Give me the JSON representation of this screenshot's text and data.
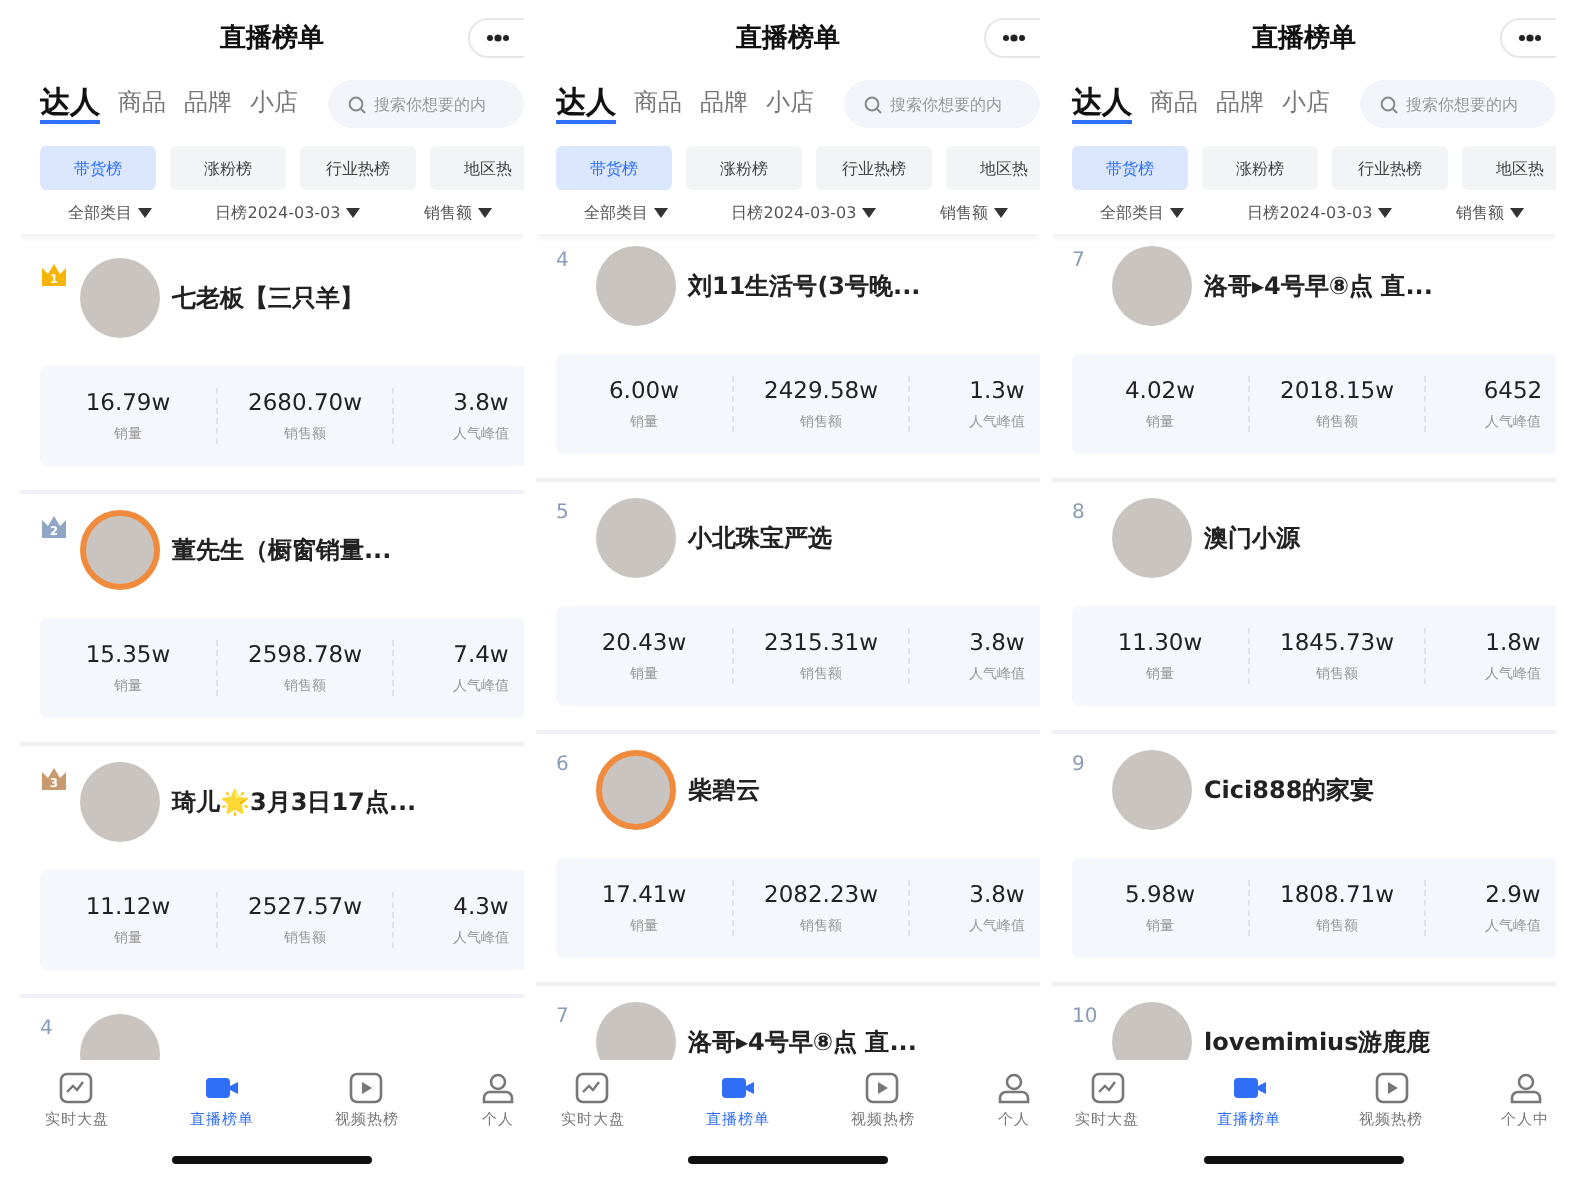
{
  "screens": [
    {
      "title": "直播榜单",
      "tabs": [
        {
          "label": "达人",
          "selected": true
        },
        {
          "label": "商品",
          "selected": false
        },
        {
          "label": "品牌",
          "selected": false
        },
        {
          "label": "小店",
          "selected": false
        }
      ],
      "search": {
        "placeholder": "搜索你想要的内"
      },
      "chips": [
        {
          "label": "带货榜",
          "selected": true
        },
        {
          "label": "涨粉榜",
          "selected": false
        },
        {
          "label": "行业热榜",
          "selected": false
        },
        {
          "label": "地区热",
          "selected": false
        }
      ],
      "filters": [
        "全部类目",
        "日榜2024-03-03",
        "销售额"
      ],
      "entries": [
        {
          "kind": "crown",
          "rank": "1",
          "color": "#f5b400",
          "name": "七老板【三只羊】",
          "live_ring": false,
          "stats": [
            {
              "value": "16.79w",
              "label": "销量"
            },
            {
              "value": "2680.70w",
              "label": "销售额"
            },
            {
              "value": "3.8w",
              "label": "人气峰值"
            }
          ]
        },
        {
          "kind": "crown",
          "rank": "2",
          "color": "#8fa6c4",
          "name": "董先生（橱窗销量...",
          "live_ring": true,
          "stats": [
            {
              "value": "15.35w",
              "label": "销量"
            },
            {
              "value": "2598.78w",
              "label": "销售额"
            },
            {
              "value": "7.4w",
              "label": "人气峰值"
            }
          ]
        },
        {
          "kind": "crown",
          "rank": "3",
          "color": "#c99a6e",
          "name": "琦儿🌟3月3日17点...",
          "live_ring": false,
          "stats": [
            {
              "value": "11.12w",
              "label": "销量"
            },
            {
              "value": "2527.57w",
              "label": "销售额"
            },
            {
              "value": "4.3w",
              "label": "人气峰值"
            }
          ]
        },
        {
          "kind": "number",
          "rank": "4",
          "live_ring": false
        }
      ],
      "nav": [
        {
          "label": "实时大盘",
          "selected": false
        },
        {
          "label": "直播榜单",
          "selected": true
        },
        {
          "label": "视频热榜",
          "selected": false
        },
        {
          "label": "个人",
          "selected": false
        }
      ]
    },
    {
      "title": "直播榜单",
      "tabs": [
        {
          "label": "达人",
          "selected": true
        },
        {
          "label": "商品",
          "selected": false
        },
        {
          "label": "品牌",
          "selected": false
        },
        {
          "label": "小店",
          "selected": false
        }
      ],
      "search": {
        "placeholder": "搜索你想要的内"
      },
      "chips": [
        {
          "label": "带货榜",
          "selected": true
        },
        {
          "label": "涨粉榜",
          "selected": false
        },
        {
          "label": "行业热榜",
          "selected": false
        },
        {
          "label": "地区热",
          "selected": false
        }
      ],
      "filters": [
        "全部类目",
        "日榜2024-03-03",
        "销售额"
      ],
      "entries": [
        {
          "kind": "number",
          "rank": "4",
          "name": "刘11生活号(3号晚...",
          "live_ring": false,
          "stats": [
            {
              "value": "6.00w",
              "label": "销量"
            },
            {
              "value": "2429.58w",
              "label": "销售额"
            },
            {
              "value": "1.3w",
              "label": "人气峰值"
            }
          ]
        },
        {
          "kind": "number",
          "rank": "5",
          "name": "小北珠宝严选",
          "live_ring": false,
          "stats": [
            {
              "value": "20.43w",
              "label": "销量"
            },
            {
              "value": "2315.31w",
              "label": "销售额"
            },
            {
              "value": "3.8w",
              "label": "人气峰值"
            }
          ]
        },
        {
          "kind": "number",
          "rank": "6",
          "name": "柴碧云",
          "live_ring": true,
          "stats": [
            {
              "value": "17.41w",
              "label": "销量"
            },
            {
              "value": "2082.23w",
              "label": "销售额"
            },
            {
              "value": "3.8w",
              "label": "人气峰值"
            }
          ]
        },
        {
          "kind": "number",
          "rank": "7",
          "name": "洛哥▸4号早⑧点 直...",
          "live_ring": false
        }
      ],
      "nav": [
        {
          "label": "实时大盘",
          "selected": false
        },
        {
          "label": "直播榜单",
          "selected": true
        },
        {
          "label": "视频热榜",
          "selected": false
        },
        {
          "label": "个人",
          "selected": false
        }
      ]
    },
    {
      "title": "直播榜单",
      "tabs": [
        {
          "label": "达人",
          "selected": true
        },
        {
          "label": "商品",
          "selected": false
        },
        {
          "label": "品牌",
          "selected": false
        },
        {
          "label": "小店",
          "selected": false
        }
      ],
      "search": {
        "placeholder": "搜索你想要的内"
      },
      "chips": [
        {
          "label": "带货榜",
          "selected": true
        },
        {
          "label": "涨粉榜",
          "selected": false
        },
        {
          "label": "行业热榜",
          "selected": false
        },
        {
          "label": "地区热",
          "selected": false
        }
      ],
      "filters": [
        "全部类目",
        "日榜2024-03-03",
        "销售额"
      ],
      "entries": [
        {
          "kind": "number",
          "rank": "7",
          "name": "洛哥▸4号早⑧点 直...",
          "live_ring": false,
          "stats": [
            {
              "value": "4.02w",
              "label": "销量"
            },
            {
              "value": "2018.15w",
              "label": "销售额"
            },
            {
              "value": "6452",
              "label": "人气峰值"
            }
          ]
        },
        {
          "kind": "number",
          "rank": "8",
          "name": "澳门小源",
          "live_ring": false,
          "stats": [
            {
              "value": "11.30w",
              "label": "销量"
            },
            {
              "value": "1845.73w",
              "label": "销售额"
            },
            {
              "value": "1.8w",
              "label": "人气峰值"
            }
          ]
        },
        {
          "kind": "number",
          "rank": "9",
          "name": "Cici888的家宴",
          "live_ring": false,
          "stats": [
            {
              "value": "5.98w",
              "label": "销量"
            },
            {
              "value": "1808.71w",
              "label": "销售额"
            },
            {
              "value": "2.9w",
              "label": "人气峰值"
            }
          ]
        },
        {
          "kind": "number",
          "rank": "10",
          "name": "lovemimius游鹿鹿",
          "live_ring": false
        }
      ],
      "nav": [
        {
          "label": "实时大盘",
          "selected": false
        },
        {
          "label": "直播榜单",
          "selected": true
        },
        {
          "label": "视频热榜",
          "selected": false
        },
        {
          "label": "个人中",
          "selected": false
        }
      ]
    }
  ]
}
